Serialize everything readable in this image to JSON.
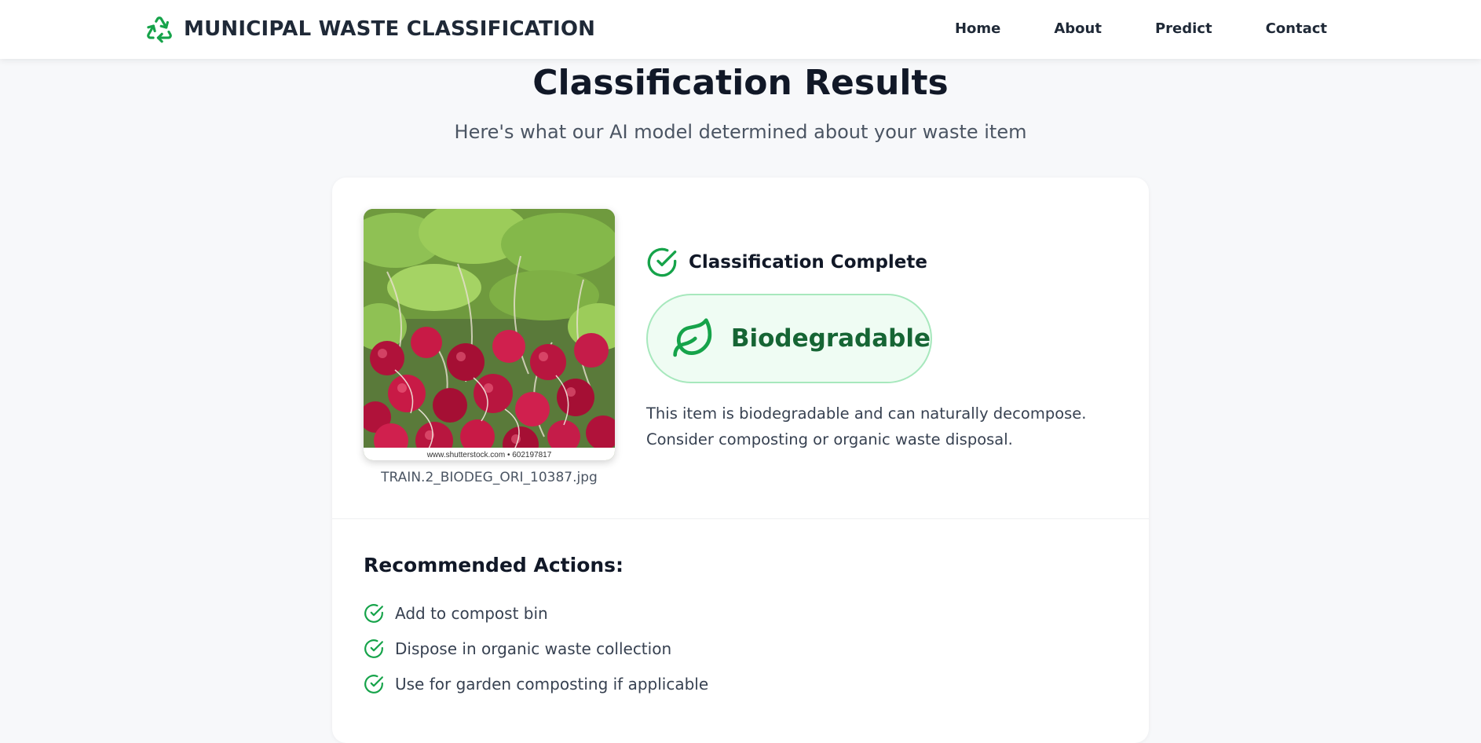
{
  "navbar": {
    "brand_title": "MUNICIPAL WASTE CLASSIFICATION",
    "brand_icon": "recycle-icon",
    "links": [
      {
        "label": "Home"
      },
      {
        "label": "About"
      },
      {
        "label": "Predict"
      },
      {
        "label": "Contact"
      }
    ]
  },
  "header": {
    "title": "Classification Results",
    "subtitle": "Here's what our AI model determined about your waste item"
  },
  "result": {
    "image_filename": "TRAIN.2_BIODEG_ORI_10387.jpg",
    "image_watermark": "www.shutterstock.com • 602197817",
    "status_label": "Classification Complete",
    "category": "Biodegradable",
    "category_icon": "leaf-icon",
    "description": "This item is biodegradable and can naturally decompose. Consider composting or organic waste disposal."
  },
  "actions": {
    "title": "Recommended Actions:",
    "items": [
      {
        "label": "Add to compost bin"
      },
      {
        "label": "Dispose in organic waste collection"
      },
      {
        "label": "Use for garden composting if applicable"
      }
    ]
  },
  "colors": {
    "accent_green": "#16a34a",
    "category_text": "#166534",
    "pill_bg": "#effcf3",
    "pill_border": "#a7e8bd",
    "page_bg": "#f7f8fa"
  }
}
